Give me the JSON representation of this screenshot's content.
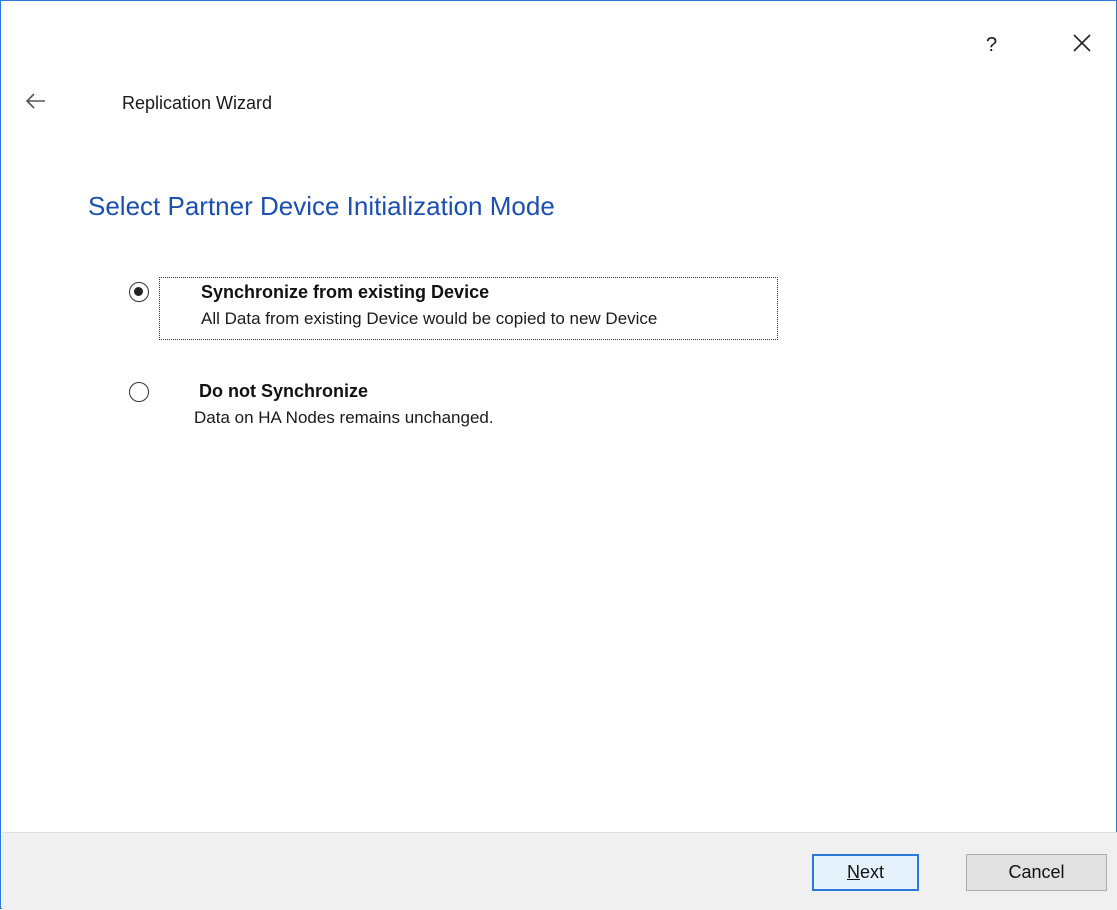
{
  "window": {
    "help_label": "?",
    "title": "Replication Wizard",
    "heading": "Select Partner Device Initialization Mode"
  },
  "icons": {
    "back": "back-arrow-icon",
    "close": "close-icon"
  },
  "options": [
    {
      "title": "Synchronize from existing Device",
      "description": "All Data from existing Device would be copied to new Device",
      "selected": true
    },
    {
      "title": "Do not Synchronize",
      "description": "Data on HA Nodes remains unchanged.",
      "selected": false
    }
  ],
  "buttons": {
    "next_first": "N",
    "next_rest": "ext",
    "cancel": "Cancel"
  },
  "colors": {
    "accent": "#2b79d8",
    "heading": "#1b4fb0",
    "footer_bg": "#f0f0f0"
  }
}
